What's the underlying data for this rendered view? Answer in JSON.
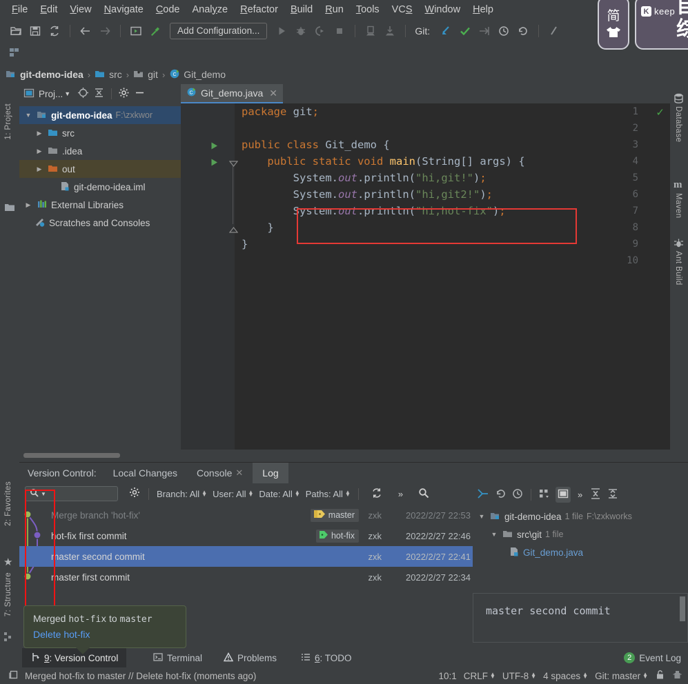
{
  "menubar": {
    "items": [
      {
        "label": "File",
        "mnemonic": "F"
      },
      {
        "label": "Edit",
        "mnemonic": "E"
      },
      {
        "label": "View",
        "mnemonic": "V"
      },
      {
        "label": "Navigate",
        "mnemonic": "N"
      },
      {
        "label": "Code",
        "mnemonic": "C"
      },
      {
        "label": "Analyze",
        "mnemonic": "y"
      },
      {
        "label": "Refactor",
        "mnemonic": "R"
      },
      {
        "label": "Build",
        "mnemonic": "B"
      },
      {
        "label": "Run",
        "mnemonic": "R"
      },
      {
        "label": "Tools",
        "mnemonic": "T"
      },
      {
        "label": "VCS",
        "mnemonic": "S"
      },
      {
        "label": "Window",
        "mnemonic": "W"
      },
      {
        "label": "Help",
        "mnemonic": "H"
      }
    ]
  },
  "toolbar": {
    "open_icon": "open-folder-icon",
    "save_icon": "save-icon",
    "sync_icon": "sync-icon",
    "back_icon": "back-arrow-icon",
    "forward_icon": "forward-arrow-icon",
    "run_config_icon": "run-config-icon",
    "build_icon": "hammer-build-icon",
    "config_label": "Add Configuration...",
    "run_icon": "run-icon",
    "debug_icon": "debug-icon",
    "run_coverage_icon": "run-with-coverage-icon",
    "stop_icon": "stop-icon",
    "attach_icon": "attach-debugger-icon",
    "pull_down_icon": "pull-down-icon",
    "git_label": "Git:",
    "git_update_icon": "git-update-project-icon",
    "git_commit_icon": "git-commit-check-icon",
    "git_push_icon": "git-push-icon",
    "git_history_icon": "git-history-clock-icon",
    "git_rollback_icon": "git-rollback-icon",
    "search_everywhere_icon": "search-everywhere-icon",
    "structure_icon": "structure-small-icon"
  },
  "breadcrumb": {
    "items": [
      {
        "label": "git-demo-idea",
        "icon": "module-icon",
        "bold": true
      },
      {
        "label": "src",
        "icon": "folder-blue-icon",
        "bold": false
      },
      {
        "label": "git",
        "icon": "package-icon",
        "bold": false
      },
      {
        "label": "Git_demo",
        "icon": "java-class-icon",
        "bold": false
      }
    ],
    "separator": "›"
  },
  "left_stripe": {
    "project_tab": "1: Project",
    "favorites_tab": "2: Favorites",
    "structure_tab": "7: Structure"
  },
  "right_stripe": {
    "tabs": [
      "Database",
      "Maven",
      "Ant Build"
    ]
  },
  "project_panel": {
    "title": "Proj...",
    "locate_icon": "locate-target-icon",
    "collapse_icon": "collapse-all-icon",
    "settings_icon": "gear-icon",
    "hide_icon": "hide-minus-icon",
    "tree": [
      {
        "label": "git-demo-idea",
        "path": "F:\\zxkwor",
        "icon": "module-icon",
        "depth": 0,
        "arrow": "▼",
        "bold": true,
        "state": "selected"
      },
      {
        "label": "src",
        "path": "",
        "icon": "folder-blue-icon",
        "depth": 1,
        "arrow": "▶",
        "bold": false,
        "state": "none"
      },
      {
        "label": ".idea",
        "path": "",
        "icon": "folder-grey-icon",
        "depth": 1,
        "arrow": "▶",
        "bold": false,
        "state": "none"
      },
      {
        "label": "out",
        "path": "",
        "icon": "folder-orange-icon",
        "depth": 1,
        "arrow": "▶",
        "bold": false,
        "state": "highlight"
      },
      {
        "label": "git-demo-idea.iml",
        "path": "",
        "icon": "iml-file-icon",
        "depth": 2,
        "arrow": "",
        "bold": false,
        "state": "none"
      },
      {
        "label": "External Libraries",
        "path": "",
        "icon": "libraries-icon",
        "depth": 0,
        "arrow": "▶",
        "bold": false,
        "state": "none"
      },
      {
        "label": "Scratches and Consoles",
        "path": "",
        "icon": "scratches-icon",
        "depth": 0,
        "arrow": "",
        "bold": false,
        "state": "none"
      }
    ]
  },
  "editor": {
    "tab": {
      "label": "Git_demo.java",
      "icon": "java-class-icon",
      "close_icon": "close-icon"
    },
    "inspection_status": "✓",
    "line_numbers": [
      "1",
      "2",
      "3",
      "4",
      "5",
      "6",
      "7",
      "8",
      "9",
      "10"
    ],
    "lines": [
      "package git;",
      "",
      "public class Git_demo {",
      "    public static void main(String[] args) {",
      "        System.out.println(\"hi,git!\");",
      "        System.out.println(\"hi,git2!\");",
      "        System.out.println(\"hi,hot-fix\");",
      "    }",
      "}",
      ""
    ],
    "highlight_box": {
      "from_line": 6,
      "to_line": 7,
      "color": "#e53935"
    },
    "run_gutter_lines": [
      3,
      4
    ]
  },
  "version_control": {
    "title": "Version Control:",
    "tabs": [
      {
        "label": "Local Changes",
        "active": false,
        "closable": false
      },
      {
        "label": "Console",
        "active": false,
        "closable": true
      },
      {
        "label": "Log",
        "active": true,
        "closable": false
      }
    ],
    "log_toolbar": {
      "search_placeholder": "",
      "search_icon": "search-icon",
      "gear_icon": "gear-icon",
      "filters": [
        {
          "label": "Branch: All"
        },
        {
          "label": "User: All"
        },
        {
          "label": "Date: All"
        },
        {
          "label": "Paths: All"
        }
      ],
      "refresh_icon": "refresh-icon",
      "more_icon": "chevron-double-right-icon",
      "find_icon": "magnifier-icon"
    },
    "commits": [
      {
        "subject": "Merge branch 'hot-fix'",
        "ref": "master",
        "ref_type": "branch-tag-double",
        "author": "zxk",
        "date": "2022/2/27 22:53",
        "selected": false,
        "faded": true
      },
      {
        "subject": "hot-fix first commit",
        "ref": "hot-fix",
        "ref_type": "branch-tag-green",
        "author": "zxk",
        "date": "2022/2/27 22:46",
        "selected": false,
        "faded": false
      },
      {
        "subject": "master second commit",
        "ref": "",
        "ref_type": "",
        "author": "zxk",
        "date": "2022/2/27 22:41",
        "selected": true,
        "faded": false
      },
      {
        "subject": "master first commit",
        "ref": "",
        "ref_type": "",
        "author": "zxk",
        "date": "2022/2/27 22:34",
        "selected": false,
        "faded": false
      }
    ],
    "changes_toolbar": {
      "expand_icon": "collapse-arrows-icon",
      "revert_icon": "revert-icon",
      "history_icon": "history-clock-icon",
      "group_icon": "group-by-icon",
      "preview_icon": "preview-pane-icon",
      "more_icon": "chevron-double-right-icon",
      "expand_all_icon": "expand-all-icon",
      "collapse_all_icon": "collapse-all-icon"
    },
    "changes_tree": [
      {
        "label": "git-demo-idea",
        "count": "1 file",
        "path": "F:\\zxkworks",
        "icon": "module-icon",
        "depth": 0,
        "arrow": "▼",
        "kind": "module"
      },
      {
        "label": "src\\git",
        "count": "1 file",
        "path": "",
        "icon": "folder-grey-icon",
        "depth": 1,
        "arrow": "▼",
        "kind": "folder"
      },
      {
        "label": "Git_demo.java",
        "count": "",
        "path": "",
        "icon": "java-file-icon",
        "depth": 2,
        "arrow": "",
        "kind": "file"
      }
    ],
    "detail_message": "master second commit"
  },
  "balloon": {
    "line1_prefix": "Merged ",
    "line1_branch": "hot-fix",
    "line1_mid": " to ",
    "line1_target": "master",
    "line2": "Delete hot-fix"
  },
  "bottom_tabs": [
    {
      "label": "9: Version Control",
      "mnemonic": "9",
      "icon": "vcs-branch-icon",
      "active": true
    },
    {
      "label": "Terminal",
      "mnemonic": "",
      "icon": "terminal-icon",
      "active": false
    },
    {
      "label": "Problems",
      "mnemonic": "",
      "icon": "warning-triangle-icon",
      "active": false
    },
    {
      "label": "6: TODO",
      "mnemonic": "6",
      "icon": "todo-list-icon",
      "active": false
    }
  ],
  "event_log": {
    "label": "Event Log",
    "count": "2"
  },
  "statusbar": {
    "message": "Merged hot-fix to master // Delete hot-fix (moments ago)",
    "message_icon": "notification-icon",
    "caret": "10:1",
    "line_sep": "CRLF",
    "encoding": "UTF-8",
    "indent": "4 spaces",
    "git_branch": "Git: master",
    "lock_icon": "unlock-icon",
    "inspector_icon": "inspector-icon"
  },
  "overlays": {
    "ime": {
      "mode": "简",
      "shirt_icon": "shirt-icon"
    },
    "keep": {
      "badge": "K",
      "name": "keep",
      "cn_text": "自综"
    }
  },
  "colors": {
    "accent_blue": "#4b6eaf",
    "tab_underline": "#4a88c7",
    "panel_bg": "#3c3f41",
    "editor_bg": "#2b2b2b",
    "gutter_bg": "#313335",
    "highlight_red": "#e53935",
    "string_green": "#6a8759",
    "keyword_orange": "#cc7832",
    "method_yellow": "#ffc66d",
    "field_purple": "#9876aa",
    "selected_tree": "#2e4a6b",
    "out_folder_highlight": "#4b452f",
    "balloon_bg": "#3c4437",
    "success_green": "#499c54"
  }
}
